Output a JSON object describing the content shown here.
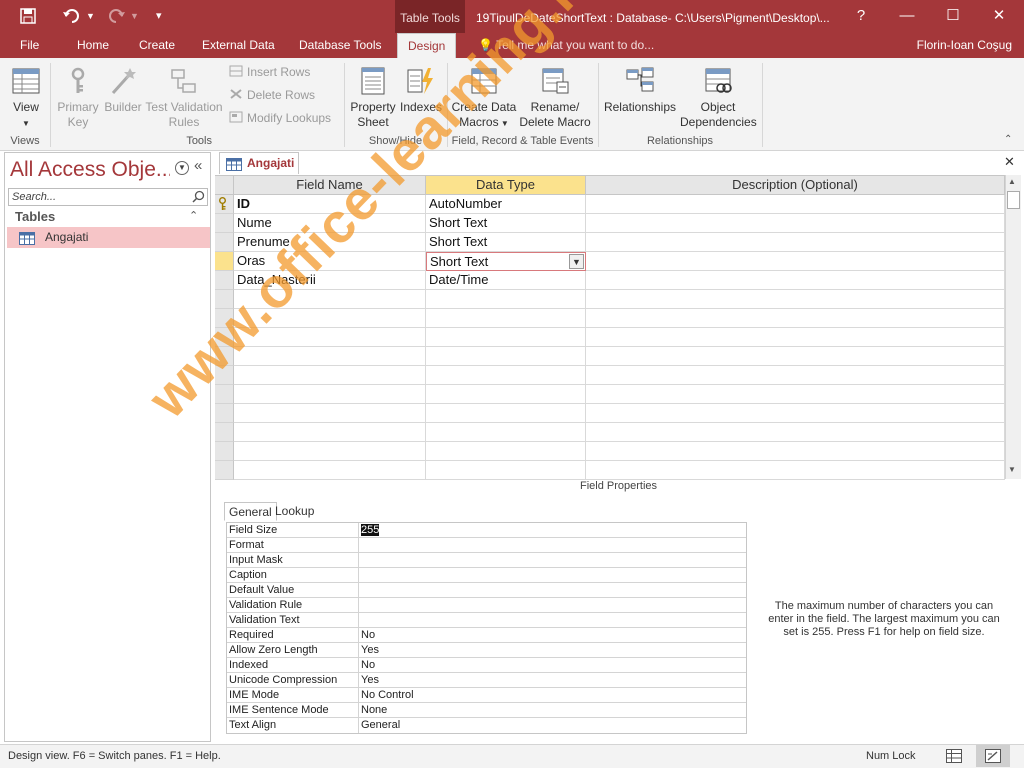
{
  "titlebar": {
    "context_tab": "Table Tools",
    "title": "19TipulDeDateShortText : Database- C:\\Users\\Pigment\\Desktop\\...",
    "help": "?",
    "minimize": "—",
    "restore": "☐",
    "close": "✕"
  },
  "tabs": {
    "file": "File",
    "home": "Home",
    "create": "Create",
    "external": "External Data",
    "dbtools": "Database Tools",
    "design": "Design",
    "tellme": "Tell me what you want to do...",
    "user": "Florin-Ioan Coşug"
  },
  "ribbon": {
    "view": "View",
    "primary_key": "Primary Key",
    "builder": "Builder",
    "test_validation": "Test Validation Rules",
    "insert_rows": "Insert Rows",
    "delete_rows": "Delete Rows",
    "modify_lookups": "Modify Lookups",
    "property_sheet": "Property Sheet",
    "indexes": "Indexes",
    "create_data_macros": "Create Data Macros",
    "rename_macro": "Rename/ Delete Macro",
    "relationships": "Relationships",
    "object_dependencies": "Object Dependencies",
    "groups": {
      "views": "Views",
      "tools": "Tools",
      "show_hide": "Show/Hide",
      "field_events": "Field, Record & Table Events",
      "relationships": "Relationships"
    }
  },
  "nav": {
    "title": "All Access Obje...",
    "search_placeholder": "Search...",
    "section": "Tables",
    "items": [
      "Angajati"
    ]
  },
  "doc": {
    "tab": "Angajati",
    "close": "✕"
  },
  "grid": {
    "headers": [
      "Field Name",
      "Data Type",
      "Description (Optional)"
    ],
    "rows": [
      {
        "name": "ID",
        "type": "AutoNumber"
      },
      {
        "name": "Nume",
        "type": "Short Text"
      },
      {
        "name": "Prenume",
        "type": "Short Text"
      },
      {
        "name": "Oras",
        "type": "Short Text"
      },
      {
        "name": "Data_Nasterii",
        "type": "Date/Time"
      }
    ]
  },
  "field_properties": {
    "label": "Field Properties",
    "tabs": [
      "General",
      "Lookup"
    ],
    "rows": [
      {
        "name": "Field Size",
        "value": "255"
      },
      {
        "name": "Format",
        "value": ""
      },
      {
        "name": "Input Mask",
        "value": ""
      },
      {
        "name": "Caption",
        "value": ""
      },
      {
        "name": "Default Value",
        "value": ""
      },
      {
        "name": "Validation Rule",
        "value": ""
      },
      {
        "name": "Validation Text",
        "value": ""
      },
      {
        "name": "Required",
        "value": "No"
      },
      {
        "name": "Allow Zero Length",
        "value": "Yes"
      },
      {
        "name": "Indexed",
        "value": "No"
      },
      {
        "name": "Unicode Compression",
        "value": "Yes"
      },
      {
        "name": "IME Mode",
        "value": "No Control"
      },
      {
        "name": "IME Sentence Mode",
        "value": "None"
      },
      {
        "name": "Text Align",
        "value": "General"
      }
    ],
    "help": "The maximum number of characters you can enter in the field. The largest maximum you can set is 255. Press F1 for help on field size."
  },
  "status": {
    "text": "Design view.  F6 = Switch panes.  F1 = Help.",
    "numlock": "Num Lock"
  },
  "watermark": "www.office-learning.ro",
  "colors": {
    "accent": "#a4373a",
    "selected_header": "#fbe28d",
    "nav_item": "#f6c5c7",
    "watermark": "#f39a2d"
  }
}
